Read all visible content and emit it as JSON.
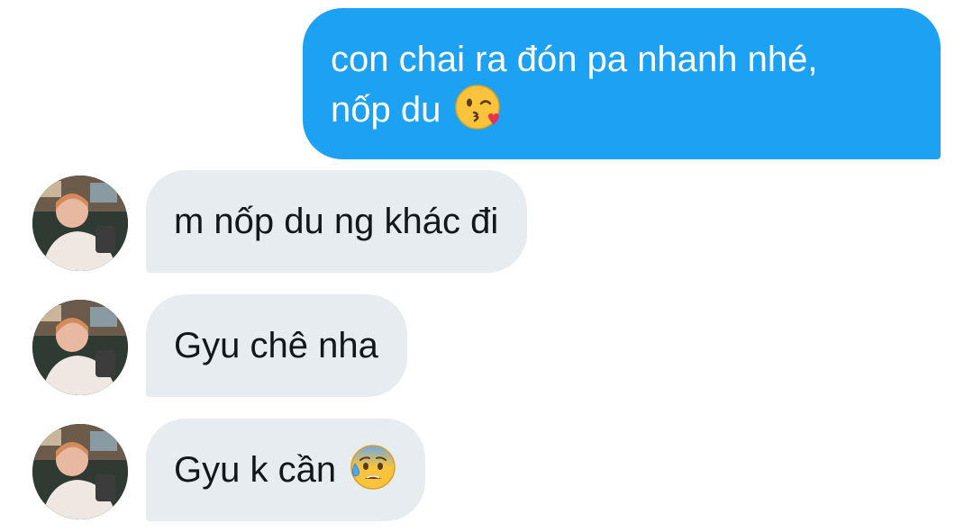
{
  "messages": {
    "outgoing": [
      {
        "line1": "con chai ra đón pa nhanh nhé,",
        "line2": "nốp du",
        "emoji": "kissing-wink-emoji"
      }
    ],
    "incoming": [
      {
        "text": "m nốp du ng khác đi"
      },
      {
        "text": "Gyu chê nha"
      },
      {
        "text": "Gyu k cần",
        "emoji": "anxious-sweat-emoji"
      }
    ]
  },
  "colors": {
    "outgoing_bubble": "#1da1f2",
    "incoming_bubble": "#e6ecf0",
    "incoming_text": "#14171a",
    "outgoing_text": "#ffffff"
  }
}
